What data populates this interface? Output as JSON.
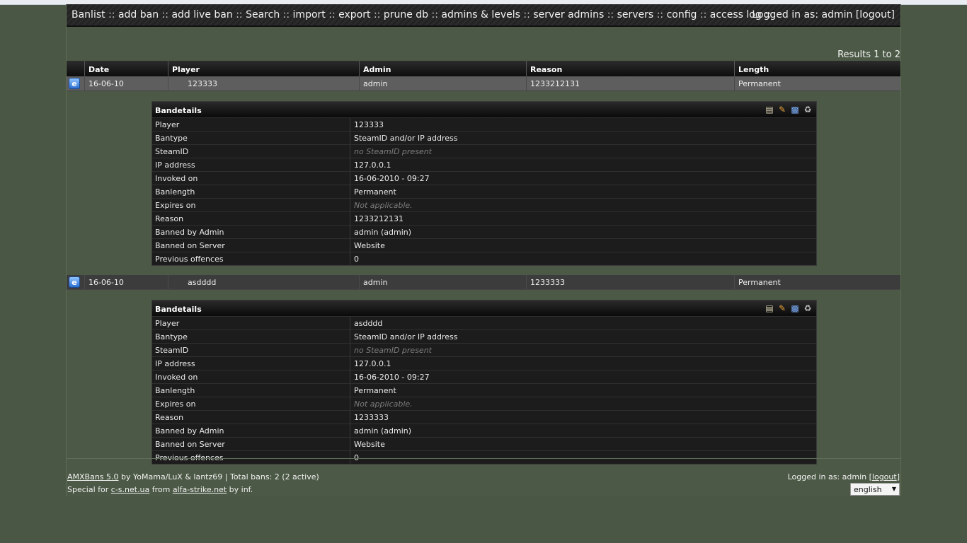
{
  "nav": {
    "items": [
      "Banlist",
      "add ban",
      "add live ban",
      "Search",
      "import",
      "export",
      "prune db",
      "admins & levels",
      "server admins",
      "servers",
      "config",
      "access log"
    ],
    "separator": "::",
    "login_text": "Logged in as: admin [logout]"
  },
  "results_text": "Results 1 to 2",
  "table": {
    "headers": [
      "Date",
      "Player",
      "Admin",
      "Reason",
      "Length"
    ],
    "rows": [
      {
        "date": "16-06-10",
        "player": "123333",
        "admin": "admin",
        "reason": "1233212131",
        "length": "Permanent"
      },
      {
        "date": "16-06-10",
        "player": "asdddd",
        "admin": "admin",
        "reason": "1233333",
        "length": "Permanent"
      }
    ]
  },
  "details": [
    {
      "title": "Bandetails",
      "fields": [
        {
          "label": "Player",
          "value": "123333"
        },
        {
          "label": "Bantype",
          "value": "SteamID and/or IP address"
        },
        {
          "label": "SteamID",
          "value": "no SteamID present"
        },
        {
          "label": "IP address",
          "value": "127.0.0.1"
        },
        {
          "label": "Invoked on",
          "value": "16-06-2010 - 09:27"
        },
        {
          "label": "Banlength",
          "value": "Permanent"
        },
        {
          "label": "Expires on",
          "value": "Not applicable."
        },
        {
          "label": "Reason",
          "value": "1233212131"
        },
        {
          "label": "Banned by Admin",
          "value": "admin (admin)"
        },
        {
          "label": "Banned on Server",
          "value": "Website"
        },
        {
          "label": "Previous offences",
          "value": "0"
        }
      ]
    },
    {
      "title": "Bandetails",
      "fields": [
        {
          "label": "Player",
          "value": "asdddd"
        },
        {
          "label": "Bantype",
          "value": "SteamID and/or IP address"
        },
        {
          "label": "SteamID",
          "value": "no SteamID present"
        },
        {
          "label": "IP address",
          "value": "127.0.0.1"
        },
        {
          "label": "Invoked on",
          "value": "16-06-2010 - 09:27"
        },
        {
          "label": "Banlength",
          "value": "Permanent"
        },
        {
          "label": "Expires on",
          "value": "Not applicable."
        },
        {
          "label": "Reason",
          "value": "1233333"
        },
        {
          "label": "Banned by Admin",
          "value": "admin (admin)"
        },
        {
          "label": "Banned on Server",
          "value": "Website"
        },
        {
          "label": "Previous offences",
          "value": "0"
        }
      ]
    }
  ],
  "footer": {
    "version_link": "AMXBans 5.0",
    "credits_text": " by YoMama/LuX & lantz69 | Total bans: 2 (2 active)",
    "special_prefix": "Special for ",
    "site1": "c-s.net.ua",
    "from_text": " from ",
    "site2": "alfa-strike.net",
    "by_text": " by inf.",
    "logged_prefix": "Logged in as: admin [",
    "logout_link": "logout",
    "logged_suffix": "]",
    "language": "english"
  },
  "icons": {
    "details_actions": [
      "list-icon",
      "edit-pencil-icon",
      "reban-icon",
      "trash-icon"
    ],
    "row_icon": "ie-browser-icon"
  }
}
